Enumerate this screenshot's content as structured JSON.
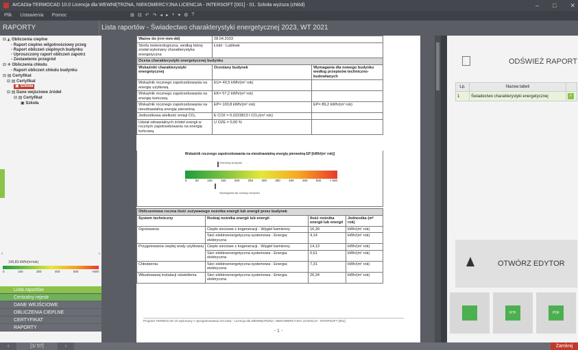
{
  "titlebar": {
    "title": "ArCADia-TERMOCAD 10.0 Licencja dla WEWNĘTRZNA, NIEKOMERCYJNA LICENCJA - INTERSOFT [001] - 01. Szkoła wyższa (chłód)",
    "controls": [
      "–",
      "□",
      "✕"
    ]
  },
  "menubar": {
    "items": [
      "Plik",
      "Ustawienia",
      "Pomoc"
    ]
  },
  "toolbar": {
    "icons": [
      "⊞",
      "⊟",
      "↶",
      "↷",
      "◂",
      "▸",
      "+",
      "▾",
      "⚙",
      "?"
    ]
  },
  "header": {
    "left_title": "RAPORTY",
    "right_title": "Lista raportów - Świadectwo charakterystyki energetycznej 2023, WT 2021"
  },
  "tree": {
    "items": [
      "Obliczenia cieplne",
      "Raport cieplno wilgotnościowy przeg",
      "Raport obliczeń cieplnych budynku",
      "Uproszczony raport obliczeń zapotrz",
      "Zestawienie przegród",
      "Obliczenia chłodu",
      "Raport obliczeń chłodu budynku",
      "Certyfikat",
      "Certyfikat",
      "Szkoła",
      "Dane wejściowe źródeł",
      "Certyfikat",
      "Szkoła"
    ]
  },
  "mini_scale": {
    "value_label": "100,83 kWh/(m²rok)",
    "ticks": [
      "0",
      "150",
      "300",
      "400",
      "500",
      ">500"
    ]
  },
  "nav": {
    "items": [
      "Lista raportów",
      "Centralny rejestr",
      "DANE WEJŚCIOWE",
      "OBLICZENIA CIEPLNE",
      "CERTYFIKAT",
      "RAPORTY"
    ]
  },
  "bottom": {
    "page_indicator": "[1/ 57]",
    "close_label": "Zamknij"
  },
  "report": {
    "rows_top": [
      {
        "label": "Ważne do (rrrr-mm-dd)",
        "value": "28.04.2033"
      },
      {
        "label": "Strefa meteorologiczna, według której został wykonany charakterystyka energetyczna",
        "value": "Łódź - Lublinek"
      }
    ],
    "section1": "Ocena charakterystyki energetycznej budynku",
    "cols": [
      "Wskaźniki charakterystyki energetycznej",
      "Oceniany budynek",
      "Wymagania dla nowego budynku według przepisów techniczno-budowlanych"
    ],
    "rows": [
      {
        "label": "Wskaźnik rocznego zapotrzebowania na energię użytkową",
        "value": "EU= 40,5 kWh/(m² rok)",
        "req": ""
      },
      {
        "label": "Wskaźnik rocznego zapotrzebowania na energię końcową",
        "value": "EK= 57,2 kWh/(m² rok)",
        "req": ""
      },
      {
        "label": "Wskaźnik rocznego zapotrzebowania na nieodnawialną energię pierwotną",
        "value": "EP= 100,8 kWh/(m² rok)",
        "req": "EP= 89,2 kWh/(m² rok)"
      },
      {
        "label": "Jednostkowa wielkość emisji CO₂",
        "value": "E CO2 = 0,0223813 t CO₂/(m² rok)",
        "req": ""
      },
      {
        "label": "Udział odnawialnych źródeł energii w rocznym zapotrzebowaniu na energię końcową",
        "value": "U OZE = 0,00 %",
        "req": ""
      }
    ],
    "scale_title": "Wskaźnik rocznego zapotrzebowania na nieodnawialną energię pierwotną EP [kWh/(m² rok)]",
    "scale_ticks": [
      "0",
      "50",
      "100",
      "150",
      "200",
      "250",
      "300",
      "350",
      "400",
      "450",
      "500",
      "> 500"
    ],
    "scale_label_top": "Oceniany budynek",
    "scale_label_bottom": "Wymagania dla nowego budynku",
    "section2": "Obliczeniowa roczna ilość zużywanego nośnika energii lub energii przez budynek",
    "cols2": [
      "System techniczny",
      "Rodzaj nośnika energii lub energii",
      "Ilość nośnika energii lub energii",
      "Jednostka (m² rok)"
    ],
    "rows2": [
      {
        "system": "Ogrzewania",
        "carrier": "Ciepło sieciowe z kogeneracji - Węgiel kamienny",
        "qty": "16,39",
        "unit": "kWh/(m² rok)"
      },
      {
        "system": "",
        "carrier": "Sieć elektroenergetyczna systemowa - Energia elektryczna",
        "qty": "4,14",
        "unit": "kWh/(m² rok)"
      },
      {
        "system": "Przygotowania ciepłej wody użytkowej",
        "carrier": "Ciepło sieciowe z kogeneracji - Węgiel kamienny",
        "qty": "14,13",
        "unit": "kWh/(m² rok)"
      },
      {
        "system": "",
        "carrier": "Sieć elektroenergetyczna systemowa - Energia elektryczna",
        "qty": "0,61",
        "unit": "kWh/(m² rok)"
      },
      {
        "system": "Chłodzenia",
        "carrier": "Sieć elektroenergetyczna systemowa - Energia elektryczna",
        "qty": "7,31",
        "unit": "kWh/(m² rok)"
      },
      {
        "system": "Wbudowanej instalacji oświetlenia",
        "carrier": "Sieć elektroenergetyczna systemowa - Energia elektryczna",
        "qty": "26,34",
        "unit": "kWh/(m² rok)"
      }
    ],
    "footer": "Program TERMOCAD 10 wykonany z oprogramowania ArCADia - Licencja dla WEWNĘTRZNA, NIEKOMERCYJNA LICENCJA - INTERSOFT [001]",
    "page_number": "- 1 -"
  },
  "right_panel": {
    "refresh_label": "ODŚWIEŻ RAPORT",
    "table_headers": [
      "Lp.",
      "Nazwa tabeli"
    ],
    "table_rows": [
      {
        "lp": "1",
        "name": "Świadectwo charakterystyki energetycznej",
        "check": "✓"
      }
    ],
    "editor_label": "OTWÓRZ EDYTOR",
    "export_labels": [
      "",
      "RTF",
      "PDF"
    ]
  },
  "colors": {
    "accent_green": "#8bc34a",
    "dark_bg": "#3a3d42",
    "close_red": "#c0392b"
  }
}
